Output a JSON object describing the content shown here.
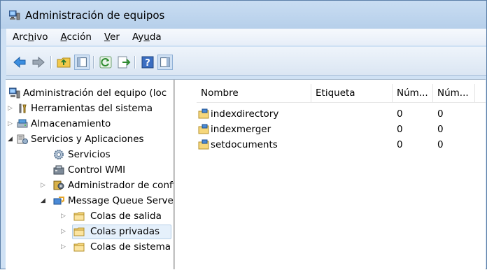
{
  "window": {
    "title": "Administración de equipos"
  },
  "menu": [
    {
      "pre": "Arc",
      "u": "h",
      "post": "ivo"
    },
    {
      "pre": "",
      "u": "A",
      "post": "cción"
    },
    {
      "pre": "",
      "u": "V",
      "post": "er"
    },
    {
      "pre": "Ay",
      "u": "u",
      "post": "da"
    }
  ],
  "toolbar": {
    "buttons": [
      "back-icon",
      "forward-icon",
      "up-folder-icon",
      "show-hide-tree-icon",
      "refresh-icon",
      "export-list-icon",
      "help-icon",
      "show-hide-action-pane-icon"
    ]
  },
  "tree": {
    "root": "Administración del equipo (loc",
    "items": [
      {
        "label": "Herramientas del sistema",
        "level": 1,
        "expander": "▷",
        "icon": "tools-icon"
      },
      {
        "label": "Almacenamiento",
        "level": 1,
        "expander": "▷",
        "icon": "storage-icon"
      },
      {
        "label": "Servicios y Aplicaciones",
        "level": 1,
        "expander": "◢",
        "icon": "services-apps-icon"
      },
      {
        "label": "Servicios",
        "level": 2,
        "expander": "",
        "icon": "services-gear-icon"
      },
      {
        "label": "Control WMI",
        "level": 2,
        "expander": "",
        "icon": "wmi-icon"
      },
      {
        "label": "Administrador de confi",
        "level": 2,
        "expander": "▷",
        "icon": "config-manager-icon"
      },
      {
        "label": "Message Queue Server",
        "level": 2,
        "expander": "◢",
        "icon": "message-queue-icon"
      },
      {
        "label": "Colas de salida",
        "level": 3,
        "expander": "▷",
        "icon": "folder-icon"
      },
      {
        "label": "Colas privadas",
        "level": 3,
        "expander": "▷",
        "icon": "folder-icon",
        "selected": true
      },
      {
        "label": "Colas de sistema",
        "level": 3,
        "expander": "▷",
        "icon": "folder-icon"
      }
    ]
  },
  "list": {
    "columns": [
      "Nombre",
      "Etiqueta",
      "Núm...",
      "Núm..."
    ],
    "rows": [
      {
        "name": "indexdirectory",
        "label": "",
        "n1": "0",
        "n2": "0"
      },
      {
        "name": "indexmerger",
        "label": "",
        "n1": "0",
        "n2": "0"
      },
      {
        "name": "setdocuments",
        "label": "",
        "n1": "0",
        "n2": "0"
      }
    ]
  }
}
